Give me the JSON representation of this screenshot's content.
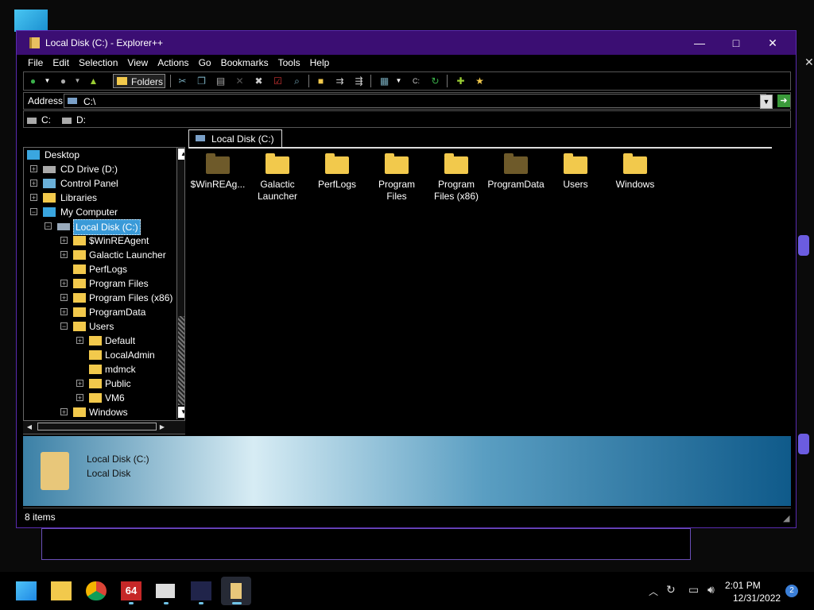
{
  "window": {
    "title": "Local Disk (C:) - Explorer++",
    "controls": {
      "minimize": "—",
      "maximize": "□",
      "close": "✕"
    }
  },
  "menu": [
    "File",
    "Edit",
    "Selection",
    "View",
    "Actions",
    "Go",
    "Bookmarks",
    "Tools",
    "Help"
  ],
  "toolbar": {
    "folders_label": "Folders",
    "icons": [
      "back-icon",
      "dropdown-icon",
      "forward-icon",
      "dropdown-icon",
      "up-folder-icon",
      "cut-icon",
      "copy-icon",
      "paste-icon",
      "delete-icon",
      "delete-permanent-icon",
      "properties-icon",
      "search-icon",
      "new-folder-icon",
      "copy-to-icon",
      "move-to-icon",
      "views-icon",
      "command-prompt-icon",
      "refresh-icon",
      "add-bookmark-icon",
      "bookmarks-icon"
    ]
  },
  "address": {
    "label": "Address",
    "value": "C:\\",
    "go": "➜"
  },
  "drives": [
    "C:",
    "D:"
  ],
  "tree": {
    "items": [
      {
        "label": "Desktop"
      },
      {
        "label": "CD Drive (D:)"
      },
      {
        "label": "Control Panel"
      },
      {
        "label": "Libraries"
      },
      {
        "label": "My Computer"
      },
      {
        "label": "Local Disk (C:)"
      },
      {
        "label": "$WinREAgent"
      },
      {
        "label": "Galactic Launcher"
      },
      {
        "label": "PerfLogs"
      },
      {
        "label": "Program Files"
      },
      {
        "label": "Program Files (x86)"
      },
      {
        "label": "ProgramData"
      },
      {
        "label": "Users"
      },
      {
        "label": "Default"
      },
      {
        "label": "LocalAdmin"
      },
      {
        "label": "mdmck"
      },
      {
        "label": "Public"
      },
      {
        "label": "VM6"
      },
      {
        "label": "Windows"
      }
    ]
  },
  "tab": {
    "label": "Local Disk (C:)"
  },
  "files": [
    {
      "line1": "$WinREAg...",
      "line2": ""
    },
    {
      "line1": "Galactic",
      "line2": "Launcher"
    },
    {
      "line1": "PerfLogs",
      "line2": ""
    },
    {
      "line1": "Program",
      "line2": "Files"
    },
    {
      "line1": "Program",
      "line2": "Files (x86)"
    },
    {
      "line1": "ProgramData",
      "line2": ""
    },
    {
      "line1": "Users",
      "line2": ""
    },
    {
      "line1": "Windows",
      "line2": ""
    }
  ],
  "info": {
    "name": "Local Disk (C:)",
    "type": "Local Disk"
  },
  "status": {
    "text": "8 items"
  },
  "taskbar": {
    "time": "2:01 PM",
    "date": "12/31/2022",
    "notifications": "2",
    "bg_close": "✕",
    "app64_label": "64"
  }
}
